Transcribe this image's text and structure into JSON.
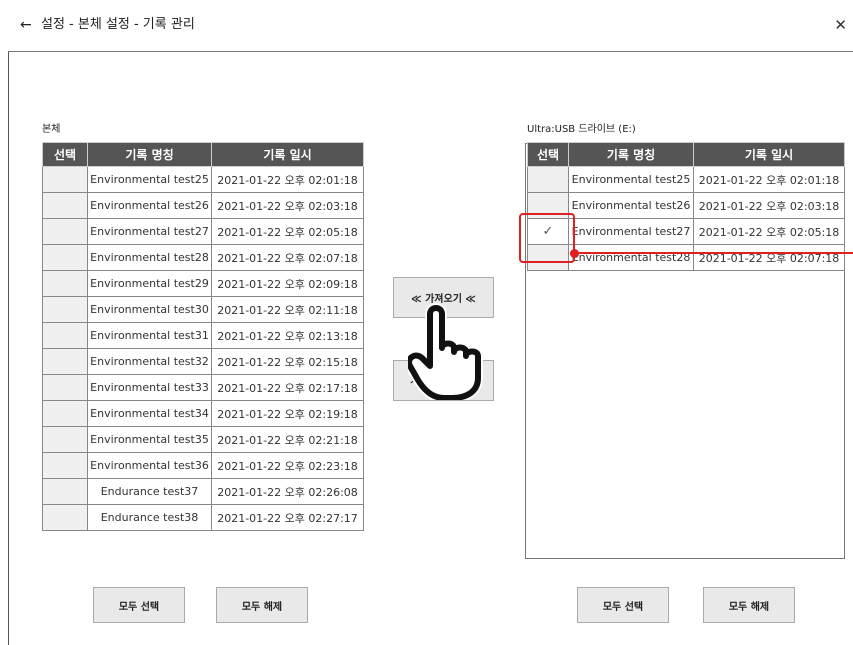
{
  "header": {
    "back_icon": "back-arrow-icon",
    "title": "설정 - 본체 설정 - 기록 관리",
    "close_icon": "close-icon"
  },
  "left_panel": {
    "label": "본체",
    "columns": [
      "선택",
      "기록 명칭",
      "기록 일시"
    ],
    "rows": [
      {
        "checked": false,
        "name": "Environmental test25",
        "date": "2021-01-22 오후 02:01:18"
      },
      {
        "checked": false,
        "name": "Environmental test26",
        "date": "2021-01-22 오후 02:03:18"
      },
      {
        "checked": false,
        "name": "Environmental test27",
        "date": "2021-01-22 오후 02:05:18"
      },
      {
        "checked": false,
        "name": "Environmental test28",
        "date": "2021-01-22 오후 02:07:18"
      },
      {
        "checked": false,
        "name": "Environmental test29",
        "date": "2021-01-22 오후 02:09:18"
      },
      {
        "checked": false,
        "name": "Environmental test30",
        "date": "2021-01-22 오후 02:11:18"
      },
      {
        "checked": false,
        "name": "Environmental test31",
        "date": "2021-01-22 오후 02:13:18"
      },
      {
        "checked": false,
        "name": "Environmental test32",
        "date": "2021-01-22 오후 02:15:18"
      },
      {
        "checked": false,
        "name": "Environmental test33",
        "date": "2021-01-22 오후 02:17:18"
      },
      {
        "checked": false,
        "name": "Environmental test34",
        "date": "2021-01-22 오후 02:19:18"
      },
      {
        "checked": false,
        "name": "Environmental test35",
        "date": "2021-01-22 오후 02:21:18"
      },
      {
        "checked": false,
        "name": "Environmental test36",
        "date": "2021-01-22 오후 02:23:18"
      },
      {
        "checked": false,
        "name": "Endurance test37",
        "date": "2021-01-22 오후 02:26:08"
      },
      {
        "checked": false,
        "name": "Endurance test38",
        "date": "2021-01-22 오후 02:27:17"
      }
    ],
    "select_all_label": "모두 선택",
    "deselect_all_label": "모두 해제"
  },
  "right_panel": {
    "label": "Ultra:USB 드라이브 (E:)",
    "columns": [
      "선택",
      "기록 명칭",
      "기록 일시"
    ],
    "rows": [
      {
        "checked": false,
        "name": "Environmental test25",
        "date": "2021-01-22 오후 02:01:18"
      },
      {
        "checked": false,
        "name": "Environmental test26",
        "date": "2021-01-22 오후 02:03:18"
      },
      {
        "checked": true,
        "name": "Environmental test27",
        "date": "2021-01-22 오후 02:05:18"
      },
      {
        "checked": false,
        "name": "Environmental test28",
        "date": "2021-01-22 오후 02:07:18"
      }
    ],
    "select_all_label": "모두 선택",
    "deselect_all_label": "모두 해제"
  },
  "transfer": {
    "import_label": "≪ 가져오기 ≪",
    "export_label": "≫"
  },
  "check_mark": "✓",
  "icons": {
    "pointer": "hand-pointer-icon",
    "check": "check-icon"
  },
  "colors": {
    "header_bg": "#555555",
    "highlight": "#e02020",
    "button_bg": "#e9e9e9"
  }
}
